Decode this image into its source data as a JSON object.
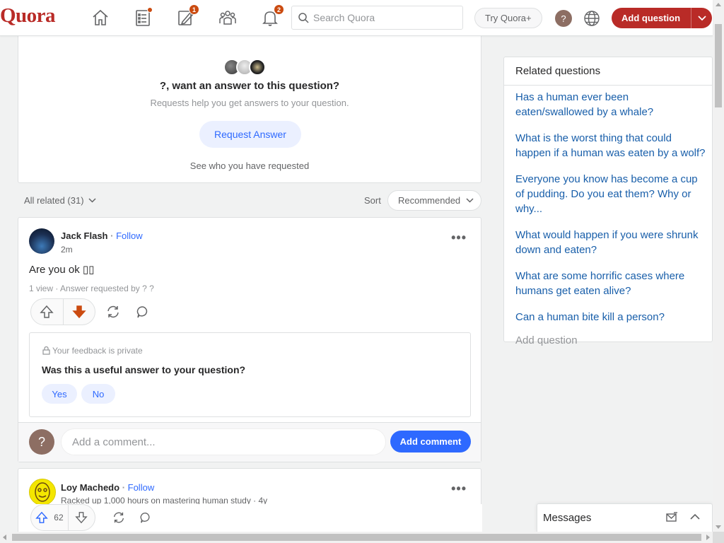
{
  "nav": {
    "logo": "Quora",
    "notifications_badge_answer": "1",
    "notifications_badge_bell": "2",
    "search_placeholder": "Search Quora",
    "try_plus": "Try Quora+",
    "avatar_letter": "?",
    "add_question": "Add question"
  },
  "request_card": {
    "title": "?, want an answer to this question?",
    "subtitle": "Requests help you get answers to your question.",
    "button": "Request Answer",
    "see_who": "See who you have requested"
  },
  "filter": {
    "all_related": "All related (31)",
    "sort_label": "Sort",
    "sort_value": "Recommended"
  },
  "answer1": {
    "author": "Jack Flash",
    "follow": "Follow",
    "time": "2m",
    "text": "Are you ok ▯▯",
    "meta": "1 view · Answer requested by ? ?",
    "feedback_private": "Your feedback is private",
    "feedback_question": "Was this a useful answer to your question?",
    "yes": "Yes",
    "no": "No",
    "comment_avatar": "?",
    "comment_placeholder": "Add a comment...",
    "comment_button": "Add comment"
  },
  "answer2": {
    "author": "Loy Machedo",
    "follow": "Follow",
    "credential": "Racked up 1,000 hours on mastering human study · 4y",
    "upvotes": "62"
  },
  "related": {
    "title": "Related questions",
    "items": [
      "Has a human ever been eaten/swallowed by a whale?",
      "What is the worst thing that could happen if a human was eaten by a wolf?",
      "Everyone you know has become a cup of pudding. Do you eat them? Why or why...",
      "What would happen if you were shrunk down and eaten?",
      "What are some horrific cases where humans get eaten alive?",
      "Can a human bite kill a person?"
    ],
    "add_question": "Add question"
  },
  "messages": {
    "label": "Messages"
  },
  "colors": {
    "brand": "#b92b27",
    "link": "#2e69ff",
    "related_link": "#195faa",
    "downvote_active": "#cb4b10"
  }
}
